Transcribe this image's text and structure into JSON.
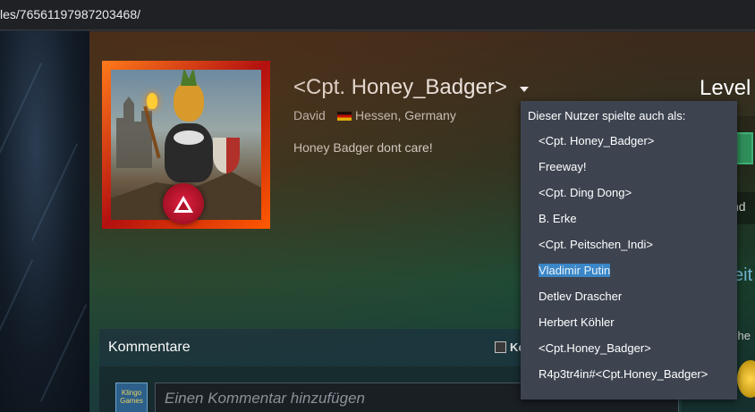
{
  "browser": {
    "url": "les/76561197987203468/"
  },
  "profile": {
    "persona_name": "<Cpt. Honey_Badger>",
    "real_name": "David",
    "location": "Hessen, Germany",
    "summary": "Honey Badger dont care!",
    "level_label": "Level"
  },
  "alias_dropdown": {
    "header": "Dieser Nutzer spielte auch als:",
    "items": [
      "<Cpt. Honey_Badger>",
      "Freeway!",
      "<Cpt. Ding Dong>",
      "B. Erke",
      "<Cpt. Peitschen_Indi>",
      "Vladimir Putin",
      "Detlev Drascher",
      "Herbert Köhler",
      "<Cpt.Honey_Badger>",
      "R4p3tr4in#<Cpt.Honey_Badger>"
    ],
    "selected_index": 5
  },
  "right_column": {
    "text1": "nd",
    "text2": "eit",
    "text3": "che"
  },
  "comments": {
    "title": "Kommentare",
    "checkbox_label": "Ko",
    "input_placeholder": "Einen Kommentar hinzufügen",
    "avatar_text": "Klingo Games"
  },
  "colors": {
    "selection": "#3a86c6",
    "dropdown_bg": "#3d4450",
    "flag": [
      "#000000",
      "#dd0000",
      "#ffce00"
    ]
  }
}
